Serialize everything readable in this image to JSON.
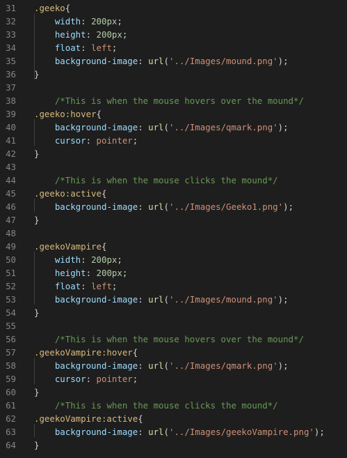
{
  "lines": [
    {
      "n": "31",
      "t": [
        {
          "c": "sel",
          "v": ".geeko"
        },
        {
          "c": "pun",
          "v": "{"
        }
      ]
    },
    {
      "n": "32",
      "t": [
        {
          "c": "pun",
          "v": "    "
        },
        {
          "c": "prop",
          "v": "width"
        },
        {
          "c": "pun",
          "v": ": "
        },
        {
          "c": "num",
          "v": "200px"
        },
        {
          "c": "pun",
          "v": ";"
        }
      ]
    },
    {
      "n": "33",
      "t": [
        {
          "c": "pun",
          "v": "    "
        },
        {
          "c": "prop",
          "v": "height"
        },
        {
          "c": "pun",
          "v": ": "
        },
        {
          "c": "num",
          "v": "200px"
        },
        {
          "c": "pun",
          "v": ";"
        }
      ]
    },
    {
      "n": "34",
      "t": [
        {
          "c": "pun",
          "v": "    "
        },
        {
          "c": "prop",
          "v": "float"
        },
        {
          "c": "pun",
          "v": ": "
        },
        {
          "c": "val",
          "v": "left"
        },
        {
          "c": "pun",
          "v": ";"
        }
      ]
    },
    {
      "n": "35",
      "t": [
        {
          "c": "pun",
          "v": "    "
        },
        {
          "c": "prop",
          "v": "background-image"
        },
        {
          "c": "pun",
          "v": ": "
        },
        {
          "c": "fn",
          "v": "url"
        },
        {
          "c": "pun",
          "v": "("
        },
        {
          "c": "val",
          "v": "'../Images/mound.png'"
        },
        {
          "c": "pun",
          "v": ");"
        }
      ]
    },
    {
      "n": "36",
      "t": [
        {
          "c": "pun",
          "v": "}"
        }
      ]
    },
    {
      "n": "37",
      "t": []
    },
    {
      "n": "38",
      "t": [
        {
          "c": "pun",
          "v": "    "
        },
        {
          "c": "cmt",
          "v": "/*This is when the mouse hovers over the mound*/"
        }
      ]
    },
    {
      "n": "39",
      "t": [
        {
          "c": "sel",
          "v": ".geeko:hover"
        },
        {
          "c": "pun",
          "v": "{"
        }
      ]
    },
    {
      "n": "40",
      "t": [
        {
          "c": "pun",
          "v": "    "
        },
        {
          "c": "prop",
          "v": "background-image"
        },
        {
          "c": "pun",
          "v": ": "
        },
        {
          "c": "fn",
          "v": "url"
        },
        {
          "c": "pun",
          "v": "("
        },
        {
          "c": "val",
          "v": "'../Images/qmark.png'"
        },
        {
          "c": "pun",
          "v": ");"
        }
      ]
    },
    {
      "n": "41",
      "t": [
        {
          "c": "pun",
          "v": "    "
        },
        {
          "c": "prop",
          "v": "cursor"
        },
        {
          "c": "pun",
          "v": ": "
        },
        {
          "c": "val",
          "v": "pointer"
        },
        {
          "c": "pun",
          "v": ";"
        }
      ]
    },
    {
      "n": "42",
      "t": [
        {
          "c": "pun",
          "v": "}"
        }
      ]
    },
    {
      "n": "43",
      "t": []
    },
    {
      "n": "44",
      "t": [
        {
          "c": "pun",
          "v": "    "
        },
        {
          "c": "cmt",
          "v": "/*This is when the mouse clicks the mound*/"
        }
      ]
    },
    {
      "n": "45",
      "t": [
        {
          "c": "sel",
          "v": ".geeko:active"
        },
        {
          "c": "pun",
          "v": "{"
        }
      ]
    },
    {
      "n": "46",
      "t": [
        {
          "c": "pun",
          "v": "    "
        },
        {
          "c": "prop",
          "v": "background-image"
        },
        {
          "c": "pun",
          "v": ": "
        },
        {
          "c": "fn",
          "v": "url"
        },
        {
          "c": "pun",
          "v": "("
        },
        {
          "c": "val",
          "v": "'../Images/Geeko1.png'"
        },
        {
          "c": "pun",
          "v": ");"
        }
      ]
    },
    {
      "n": "47",
      "t": [
        {
          "c": "pun",
          "v": "}"
        }
      ]
    },
    {
      "n": "48",
      "t": []
    },
    {
      "n": "49",
      "t": [
        {
          "c": "sel",
          "v": ".geekoVampire"
        },
        {
          "c": "pun",
          "v": "{"
        }
      ]
    },
    {
      "n": "50",
      "t": [
        {
          "c": "pun",
          "v": "    "
        },
        {
          "c": "prop",
          "v": "width"
        },
        {
          "c": "pun",
          "v": ": "
        },
        {
          "c": "num",
          "v": "200px"
        },
        {
          "c": "pun",
          "v": ";"
        }
      ]
    },
    {
      "n": "51",
      "t": [
        {
          "c": "pun",
          "v": "    "
        },
        {
          "c": "prop",
          "v": "height"
        },
        {
          "c": "pun",
          "v": ": "
        },
        {
          "c": "num",
          "v": "200px"
        },
        {
          "c": "pun",
          "v": ";"
        }
      ]
    },
    {
      "n": "52",
      "t": [
        {
          "c": "pun",
          "v": "    "
        },
        {
          "c": "prop",
          "v": "float"
        },
        {
          "c": "pun",
          "v": ": "
        },
        {
          "c": "val",
          "v": "left"
        },
        {
          "c": "pun",
          "v": ";"
        }
      ]
    },
    {
      "n": "53",
      "t": [
        {
          "c": "pun",
          "v": "    "
        },
        {
          "c": "prop",
          "v": "background-image"
        },
        {
          "c": "pun",
          "v": ": "
        },
        {
          "c": "fn",
          "v": "url"
        },
        {
          "c": "pun",
          "v": "("
        },
        {
          "c": "val",
          "v": "'../Images/mound.png'"
        },
        {
          "c": "pun",
          "v": ");"
        }
      ]
    },
    {
      "n": "54",
      "t": [
        {
          "c": "pun",
          "v": "}"
        }
      ]
    },
    {
      "n": "55",
      "t": []
    },
    {
      "n": "56",
      "t": [
        {
          "c": "pun",
          "v": "    "
        },
        {
          "c": "cmt",
          "v": "/*This is when the mouse hovers over the mound*/"
        }
      ]
    },
    {
      "n": "57",
      "t": [
        {
          "c": "sel",
          "v": ".geekoVampire:hover"
        },
        {
          "c": "pun",
          "v": "{"
        }
      ]
    },
    {
      "n": "58",
      "t": [
        {
          "c": "pun",
          "v": "    "
        },
        {
          "c": "prop",
          "v": "background-image"
        },
        {
          "c": "pun",
          "v": ": "
        },
        {
          "c": "fn",
          "v": "url"
        },
        {
          "c": "pun",
          "v": "("
        },
        {
          "c": "val",
          "v": "'../Images/qmark.png'"
        },
        {
          "c": "pun",
          "v": ");"
        }
      ]
    },
    {
      "n": "59",
      "t": [
        {
          "c": "pun",
          "v": "    "
        },
        {
          "c": "prop",
          "v": "cursor"
        },
        {
          "c": "pun",
          "v": ": "
        },
        {
          "c": "val",
          "v": "pointer"
        },
        {
          "c": "pun",
          "v": ";"
        }
      ]
    },
    {
      "n": "60",
      "t": [
        {
          "c": "pun",
          "v": "}"
        }
      ]
    },
    {
      "n": "61",
      "t": [
        {
          "c": "pun",
          "v": "    "
        },
        {
          "c": "cmt",
          "v": "/*This is when the mouse clicks the mound*/"
        }
      ]
    },
    {
      "n": "62",
      "t": [
        {
          "c": "sel",
          "v": ".geekoVampire:active"
        },
        {
          "c": "pun",
          "v": "{"
        }
      ]
    },
    {
      "n": "63",
      "t": [
        {
          "c": "pun",
          "v": "    "
        },
        {
          "c": "prop",
          "v": "background-image"
        },
        {
          "c": "pun",
          "v": ": "
        },
        {
          "c": "fn",
          "v": "url"
        },
        {
          "c": "pun",
          "v": "("
        },
        {
          "c": "val",
          "v": "'../Images/geekoVampire.png'"
        },
        {
          "c": "pun",
          "v": ");"
        }
      ]
    },
    {
      "n": "64",
      "t": [
        {
          "c": "pun",
          "v": "}"
        }
      ]
    }
  ],
  "colors": {
    "background": "#1e1e1e",
    "line_number": "#858585",
    "selector": "#d7ba7d",
    "property": "#9cdcfe",
    "string": "#ce9178",
    "number": "#b5cea8",
    "function": "#dcdcaa",
    "comment": "#6a9955",
    "punctuation": "#d4d4d4"
  }
}
